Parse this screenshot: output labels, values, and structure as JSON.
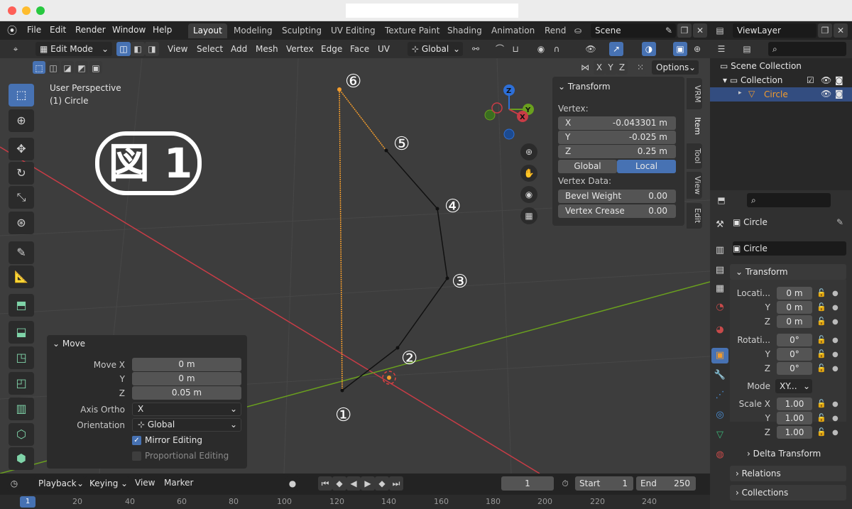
{
  "topbar": {
    "menus": [
      "File",
      "Edit",
      "Render",
      "Window",
      "Help"
    ],
    "workspaces": [
      "Layout",
      "Modeling",
      "Sculpting",
      "UV Editing",
      "Texture Paint",
      "Shading",
      "Animation",
      "Rend"
    ],
    "active_workspace": "Layout",
    "scene": "Scene",
    "view_layer": "ViewLayer"
  },
  "header": {
    "mode": "Edit Mode",
    "menus": [
      "View",
      "Select",
      "Add",
      "Mesh",
      "Vertex",
      "Edge",
      "Face",
      "UV"
    ],
    "orientation": "Global",
    "options_label": "Options",
    "axes": [
      "X",
      "Y",
      "Z"
    ]
  },
  "viewport": {
    "perspective": "User Perspective",
    "object_label": "(1) Circle",
    "figure_label": "図 1",
    "vertex_labels": [
      "①",
      "②",
      "③",
      "④",
      "⑤",
      "⑥"
    ],
    "gizmo_axes": {
      "x": "X",
      "y": "Y",
      "z": "Z"
    }
  },
  "npanel": {
    "title": "Transform",
    "vertex_label": "Vertex:",
    "x_label": "X",
    "x_value": "-0.043301 m",
    "y_label": "Y",
    "y_value": "-0.025 m",
    "z_label": "Z",
    "z_value": "0.25 m",
    "global_label": "Global",
    "local_label": "Local",
    "vertex_data_label": "Vertex Data:",
    "bevel_weight_label": "Bevel Weight",
    "bevel_weight_value": "0.00",
    "vertex_crease_label": "Vertex Crease",
    "vertex_crease_value": "0.00",
    "tabs": [
      "VRM",
      "Item",
      "Tool",
      "View",
      "Edit"
    ],
    "active_tab": "Item"
  },
  "move_panel": {
    "title": "Move",
    "move_x_label": "Move X",
    "move_x": "0 m",
    "y_label": "Y",
    "y": "0 m",
    "z_label": "Z",
    "z": "0.05 m",
    "axis_ortho_label": "Axis Ortho",
    "axis_ortho": "X",
    "orientation_label": "Orientation",
    "orientation": "Global",
    "mirror_editing": "Mirror Editing",
    "mirror_editing_checked": true,
    "proportional_editing": "Proportional Editing",
    "proportional_editing_checked": false
  },
  "timeline": {
    "menus": [
      "Playback",
      "Keying",
      "View",
      "Marker"
    ],
    "current_frame": "1",
    "start_label": "Start",
    "start": "1",
    "end_label": "End",
    "end": "250",
    "ticks": [
      "1",
      "20",
      "40",
      "60",
      "80",
      "100",
      "120",
      "140",
      "160",
      "180",
      "200",
      "220",
      "240"
    ]
  },
  "outliner": {
    "scene_collection": "Scene Collection",
    "collection": "Collection",
    "object": "Circle"
  },
  "properties": {
    "object_name": "Circle",
    "data_name": "Circle",
    "transform_label": "Transform",
    "location_label": "Locati...",
    "location": [
      "0 m",
      "0 m",
      "0 m"
    ],
    "rotation_label": "Rotati...",
    "rotation": [
      "0°",
      "0°",
      "0°"
    ],
    "mode_label": "Mode",
    "mode": "XY...",
    "scale_label": "Scale X",
    "scale": [
      "1.00",
      "1.00",
      "1.00"
    ],
    "axis_y": "Y",
    "axis_z": "Z",
    "delta_transform": "Delta Transform",
    "relations": "Relations",
    "collections": "Collections"
  },
  "colors": {
    "accent": "#4772b3",
    "x_axis": "#c83c46",
    "y_axis": "#6aa01e",
    "selected_edge": "#f39c2c"
  }
}
